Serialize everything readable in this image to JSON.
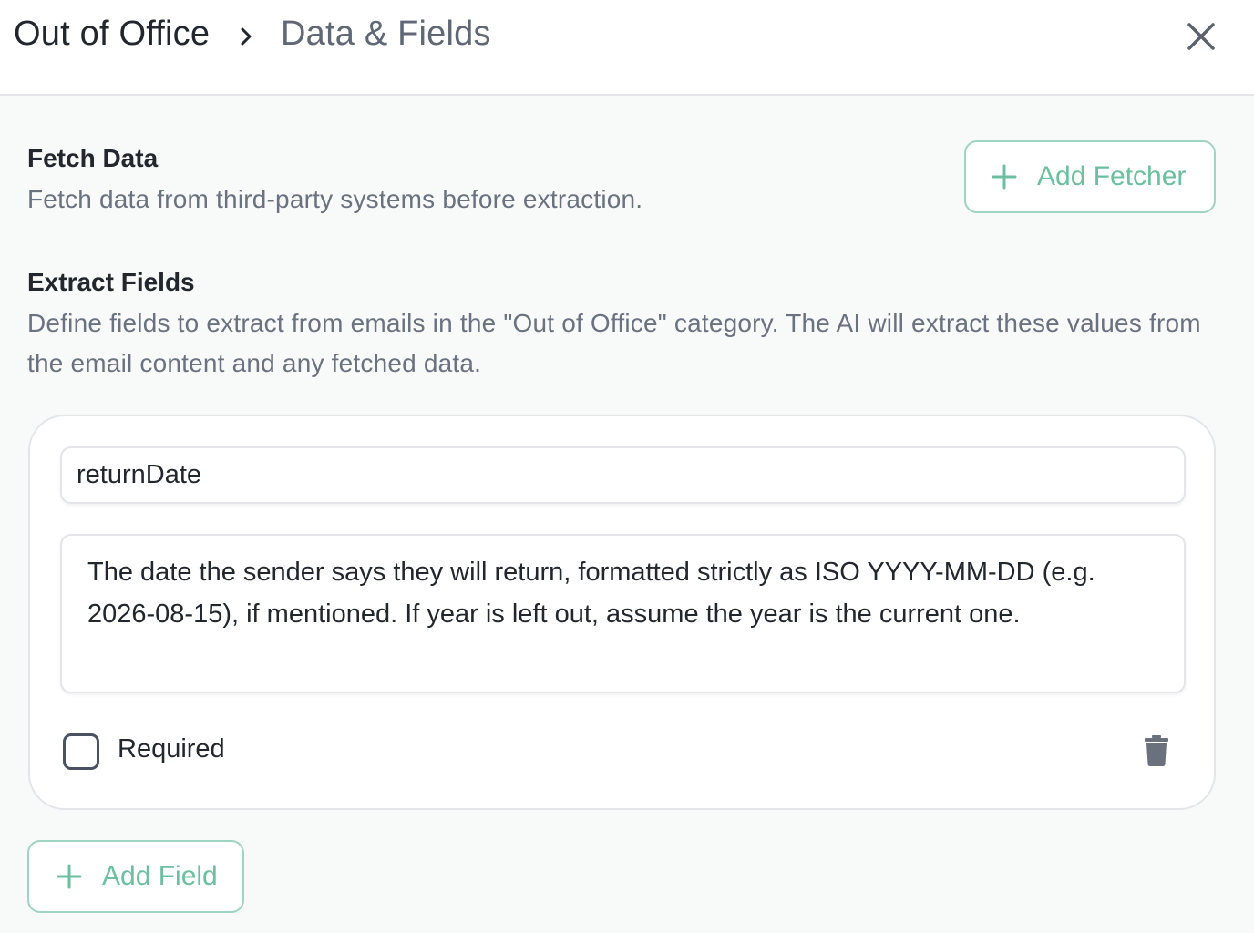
{
  "header": {
    "breadcrumb_root": "Out of Office",
    "breadcrumb_current": "Data & Fields",
    "icons": {
      "separator": "chevron-right-icon",
      "close": "close-icon"
    }
  },
  "fetch_section": {
    "title": "Fetch Data",
    "description": "Fetch data from third-party systems before extraction.",
    "add_button_label": "Add Fetcher"
  },
  "extract_section": {
    "title": "Extract Fields",
    "description": "Define fields to extract from emails in the \"Out of Office\" category. The AI will extract these values from the email content and any fetched data.",
    "fields": [
      {
        "name": "returnDate",
        "description": "The date the sender says they will return, formatted strictly as ISO YYYY-MM-DD (e.g. 2026-08-15), if mentioned. If year is left out, assume the year is the current one.",
        "required_label": "Required",
        "required": false,
        "delete_icon": "trash-icon"
      }
    ],
    "add_button_label": "Add Field"
  },
  "colors": {
    "accent": "#6cbf9f",
    "accent_border": "#9fd4c0",
    "text": "#22262d",
    "muted_text": "#6a7280",
    "background": "#f8f9f9"
  }
}
